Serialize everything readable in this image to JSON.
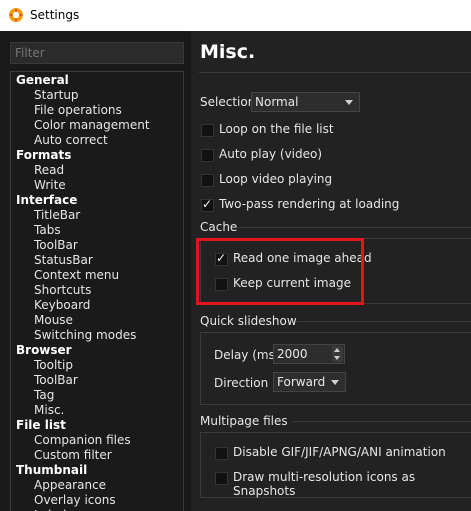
{
  "window": {
    "title": "Settings"
  },
  "sidebar": {
    "filter_placeholder": "Filter",
    "tree": [
      {
        "type": "group",
        "label": "General"
      },
      {
        "type": "child",
        "label": "Startup"
      },
      {
        "type": "child",
        "label": "File operations"
      },
      {
        "type": "child",
        "label": "Color management"
      },
      {
        "type": "child",
        "label": "Auto correct"
      },
      {
        "type": "group",
        "label": "Formats"
      },
      {
        "type": "child",
        "label": "Read"
      },
      {
        "type": "child",
        "label": "Write"
      },
      {
        "type": "group",
        "label": "Interface"
      },
      {
        "type": "child",
        "label": "TitleBar"
      },
      {
        "type": "child",
        "label": "Tabs"
      },
      {
        "type": "child",
        "label": "ToolBar"
      },
      {
        "type": "child",
        "label": "StatusBar"
      },
      {
        "type": "child",
        "label": "Context menu"
      },
      {
        "type": "child",
        "label": "Shortcuts"
      },
      {
        "type": "child",
        "label": "Keyboard"
      },
      {
        "type": "child",
        "label": "Mouse"
      },
      {
        "type": "child",
        "label": "Switching modes"
      },
      {
        "type": "group",
        "label": "Browser"
      },
      {
        "type": "child",
        "label": "Tooltip"
      },
      {
        "type": "child",
        "label": "ToolBar"
      },
      {
        "type": "child",
        "label": "Tag"
      },
      {
        "type": "child",
        "label": "Misc."
      },
      {
        "type": "group",
        "label": "File list"
      },
      {
        "type": "child",
        "label": "Companion files"
      },
      {
        "type": "child",
        "label": "Custom filter"
      },
      {
        "type": "group",
        "label": "Thumbnail"
      },
      {
        "type": "child",
        "label": "Appearance"
      },
      {
        "type": "child",
        "label": "Overlay icons"
      },
      {
        "type": "child",
        "label": "Labels"
      }
    ]
  },
  "main": {
    "title": "Misc.",
    "selection": {
      "label": "Selection",
      "value": "Normal"
    },
    "options": [
      {
        "label": "Loop on the file list",
        "checked": false
      },
      {
        "label": "Auto play (video)",
        "checked": false
      },
      {
        "label": "Loop video playing",
        "checked": false
      },
      {
        "label": "Two-pass rendering at loading",
        "checked": true
      }
    ],
    "cache": {
      "title": "Cache",
      "options": [
        {
          "label": "Read one image ahead",
          "checked": true
        },
        {
          "label": "Keep current image",
          "checked": false
        }
      ]
    },
    "slideshow": {
      "title": "Quick slideshow",
      "delay_label": "Delay (ms)",
      "delay_value": "2000",
      "direction_label": "Direction",
      "direction_value": "Forward"
    },
    "multipage": {
      "title": "Multipage files",
      "options": [
        {
          "label": "Disable GIF/JIF/APNG/ANI animation",
          "checked": false
        },
        {
          "label": "Draw multi-resolution icons as Snapshots",
          "checked": false
        }
      ]
    },
    "colors": {
      "highlight": "#e3141b"
    }
  }
}
